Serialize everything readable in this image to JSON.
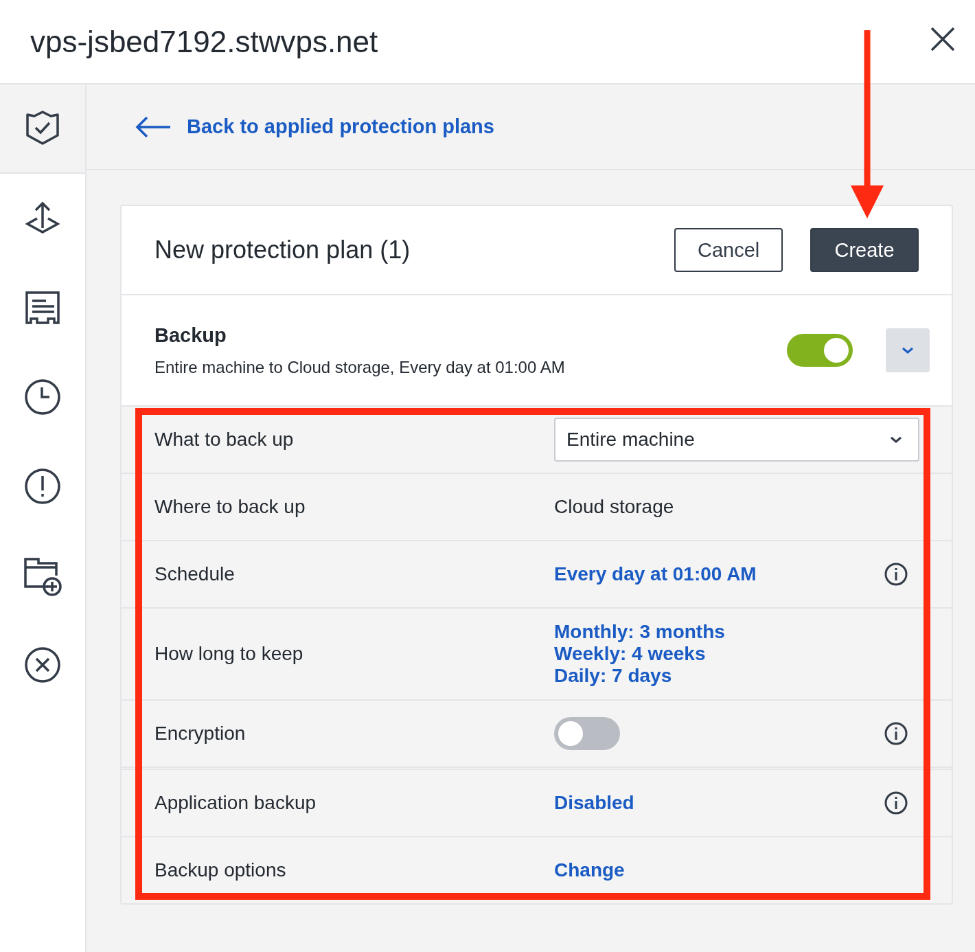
{
  "window": {
    "title": "vps-jsbed7192.stwvps.net"
  },
  "sidebar": {
    "items": [
      {
        "selected": true
      },
      {
        "selected": false
      },
      {
        "selected": false
      },
      {
        "selected": false
      },
      {
        "selected": false
      },
      {
        "selected": false
      },
      {
        "selected": false
      }
    ]
  },
  "back_link": "Back to applied protection plans",
  "plan": {
    "title": "New protection plan (1)",
    "buttons": [
      {
        "label": "Cancel",
        "kind": "secondary"
      },
      {
        "label": "Create",
        "kind": "primary"
      }
    ]
  },
  "backup": {
    "title": "Backup",
    "summary": "Entire machine to Cloud storage, Every day at 01:00 AM",
    "on": true
  },
  "rows": [
    {
      "label": "What to back up",
      "kind": "select",
      "value": "Entire machine",
      "info": false
    },
    {
      "label": "Where to back up",
      "kind": "text",
      "value": "Cloud storage",
      "info": false
    },
    {
      "label": "Schedule",
      "kind": "link",
      "value": "Every day at 01:00 AM",
      "info": true
    },
    {
      "label": "How long to keep",
      "kind": "links",
      "values": [
        "Monthly: 3 months",
        "Weekly: 4 weeks",
        "Daily: 7 days"
      ],
      "info": false
    },
    {
      "label": "Encryption",
      "kind": "toggle",
      "on": false,
      "info": true
    },
    {
      "label": "Application backup",
      "kind": "link",
      "value": "Disabled",
      "info": true
    },
    {
      "label": "Backup options",
      "kind": "link",
      "value": "Change",
      "info": false
    }
  ]
}
